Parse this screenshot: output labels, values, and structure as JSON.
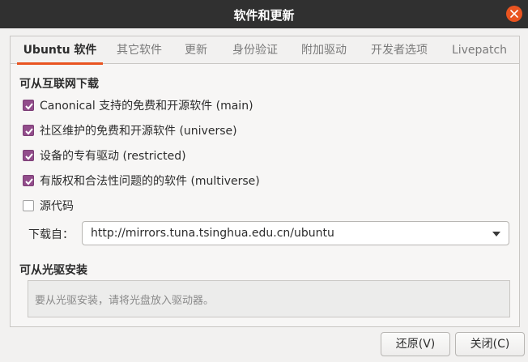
{
  "window": {
    "title": "软件和更新"
  },
  "tabs": [
    {
      "label": "Ubuntu 软件",
      "active": true
    },
    {
      "label": "其它软件",
      "active": false
    },
    {
      "label": "更新",
      "active": false
    },
    {
      "label": "身份验证",
      "active": false
    },
    {
      "label": "附加驱动",
      "active": false
    },
    {
      "label": "开发者选项",
      "active": false
    },
    {
      "label": "Livepatch",
      "active": false
    }
  ],
  "internet": {
    "heading": "可从互联网下载",
    "options": [
      {
        "label": "Canonical 支持的免费和开源软件 (main)",
        "checked": true
      },
      {
        "label": "社区维护的免费和开源软件 (universe)",
        "checked": true
      },
      {
        "label": "设备的专有驱动 (restricted)",
        "checked": true
      },
      {
        "label": "有版权和合法性问题的的软件 (multiverse)",
        "checked": true
      },
      {
        "label": "源代码",
        "checked": false
      }
    ],
    "download_from_label": "下载自：",
    "download_from_value": "http://mirrors.tuna.tsinghua.edu.cn/ubuntu"
  },
  "cdrom": {
    "heading": "可从光驱安装",
    "placeholder": "要从光驱安装，请将光盘放入驱动器。"
  },
  "buttons": {
    "revert": "还原(V)",
    "close": "关闭(C)"
  },
  "colors": {
    "accent": "#e95420",
    "checkbox": "#924d8b",
    "titlebar": "#303030"
  }
}
